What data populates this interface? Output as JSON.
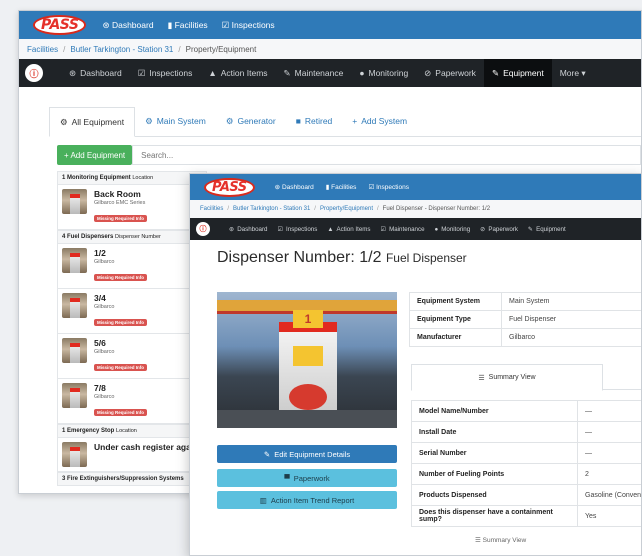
{
  "back": {
    "logo": "PASS",
    "topnav": [
      "Dashboard",
      "Facilities",
      "Inspections"
    ],
    "breadcrumb": [
      "Facilities",
      "Butler Tarkington - Station 31",
      "Property/Equipment"
    ],
    "mainnav": [
      {
        "icon": "⊛",
        "label": "Dashboard"
      },
      {
        "icon": "☑",
        "label": "Inspections"
      },
      {
        "icon": "▲",
        "label": "Action Items"
      },
      {
        "icon": "✎",
        "label": "Maintenance"
      },
      {
        "icon": "●",
        "label": "Monitoring"
      },
      {
        "icon": "⊘",
        "label": "Paperwork"
      },
      {
        "icon": "✎",
        "label": "Equipment"
      },
      {
        "icon": "",
        "label": "More ▾"
      }
    ],
    "tabs": [
      {
        "icon": "⚙",
        "label": "All Equipment"
      },
      {
        "icon": "⚙",
        "label": "Main System"
      },
      {
        "icon": "⚙",
        "label": "Generator"
      },
      {
        "icon": "■",
        "label": "Retired"
      },
      {
        "icon": "+",
        "label": "Add System"
      }
    ],
    "add_button": "+ Add Equipment",
    "search_placeholder": "Search...",
    "groups": [
      {
        "title": "1 Monitoring Equipment",
        "sub": "Location",
        "items": [
          {
            "name": "Back Room",
            "sub": "Gilbarco EMC Series",
            "badge": "Missing Required Info"
          }
        ]
      },
      {
        "title": "4 Fuel Dispensers",
        "sub": "Dispenser Number",
        "items": [
          {
            "name": "1/2",
            "sub": "Gilbarco",
            "badge": "Missing Required Info"
          },
          {
            "name": "3/4",
            "sub": "Gilbarco",
            "badge": "Missing Required Info"
          },
          {
            "name": "5/6",
            "sub": "Gilbarco",
            "badge": "Missing Required Info"
          },
          {
            "name": "7/8",
            "sub": "Gilbarco",
            "badge": "Missing Required Info"
          }
        ]
      },
      {
        "title": "1 Emergency Stop",
        "sub": "Location",
        "items": [
          {
            "name": "Under cash register again",
            "sub": "",
            "badge": ""
          }
        ]
      },
      {
        "title": "3 Fire Extinguishers/Suppression Systems",
        "sub": "",
        "items": []
      }
    ]
  },
  "front": {
    "logo": "PASS",
    "topnav": [
      "Dashboard",
      "Facilities",
      "Inspections"
    ],
    "breadcrumb": [
      "Facilities",
      "Butler Tarkington - Station 31",
      "Property/Equipment",
      "Fuel Dispenser - Dispenser Number: 1/2"
    ],
    "mainnav": [
      {
        "icon": "⊛",
        "label": "Dashboard"
      },
      {
        "icon": "☑",
        "label": "Inspections"
      },
      {
        "icon": "▲",
        "label": "Action Items"
      },
      {
        "icon": "☑",
        "label": "Maintenance"
      },
      {
        "icon": "●",
        "label": "Monitoring"
      },
      {
        "icon": "⊘",
        "label": "Paperwork"
      },
      {
        "icon": "✎",
        "label": "Equipment"
      }
    ],
    "title": "Dispenser Number: 1/2",
    "title_type": "Fuel Dispenser",
    "pump_number": "1",
    "details": [
      {
        "k": "Equipment System",
        "v": "Main System"
      },
      {
        "k": "Equipment Type",
        "v": "Fuel Dispenser"
      },
      {
        "k": "Manufacturer",
        "v": "Gilbarco"
      }
    ],
    "summary_tab": "Summary View",
    "summary": [
      {
        "k": "Model Name/Number",
        "v": "—"
      },
      {
        "k": "Install Date",
        "v": "—"
      },
      {
        "k": "Serial Number",
        "v": "—"
      },
      {
        "k": "Number of Fueling Points",
        "v": "2"
      },
      {
        "k": "Products Dispensed",
        "v": "Gasoline (Conven"
      },
      {
        "k": "Does this dispenser have a containment sump?",
        "v": "Yes"
      }
    ],
    "buttons": {
      "edit": "Edit Equipment Details",
      "paperwork": "Paperwork",
      "trend": "Action Item Trend Report"
    },
    "ghost_tab": "Summary View"
  }
}
